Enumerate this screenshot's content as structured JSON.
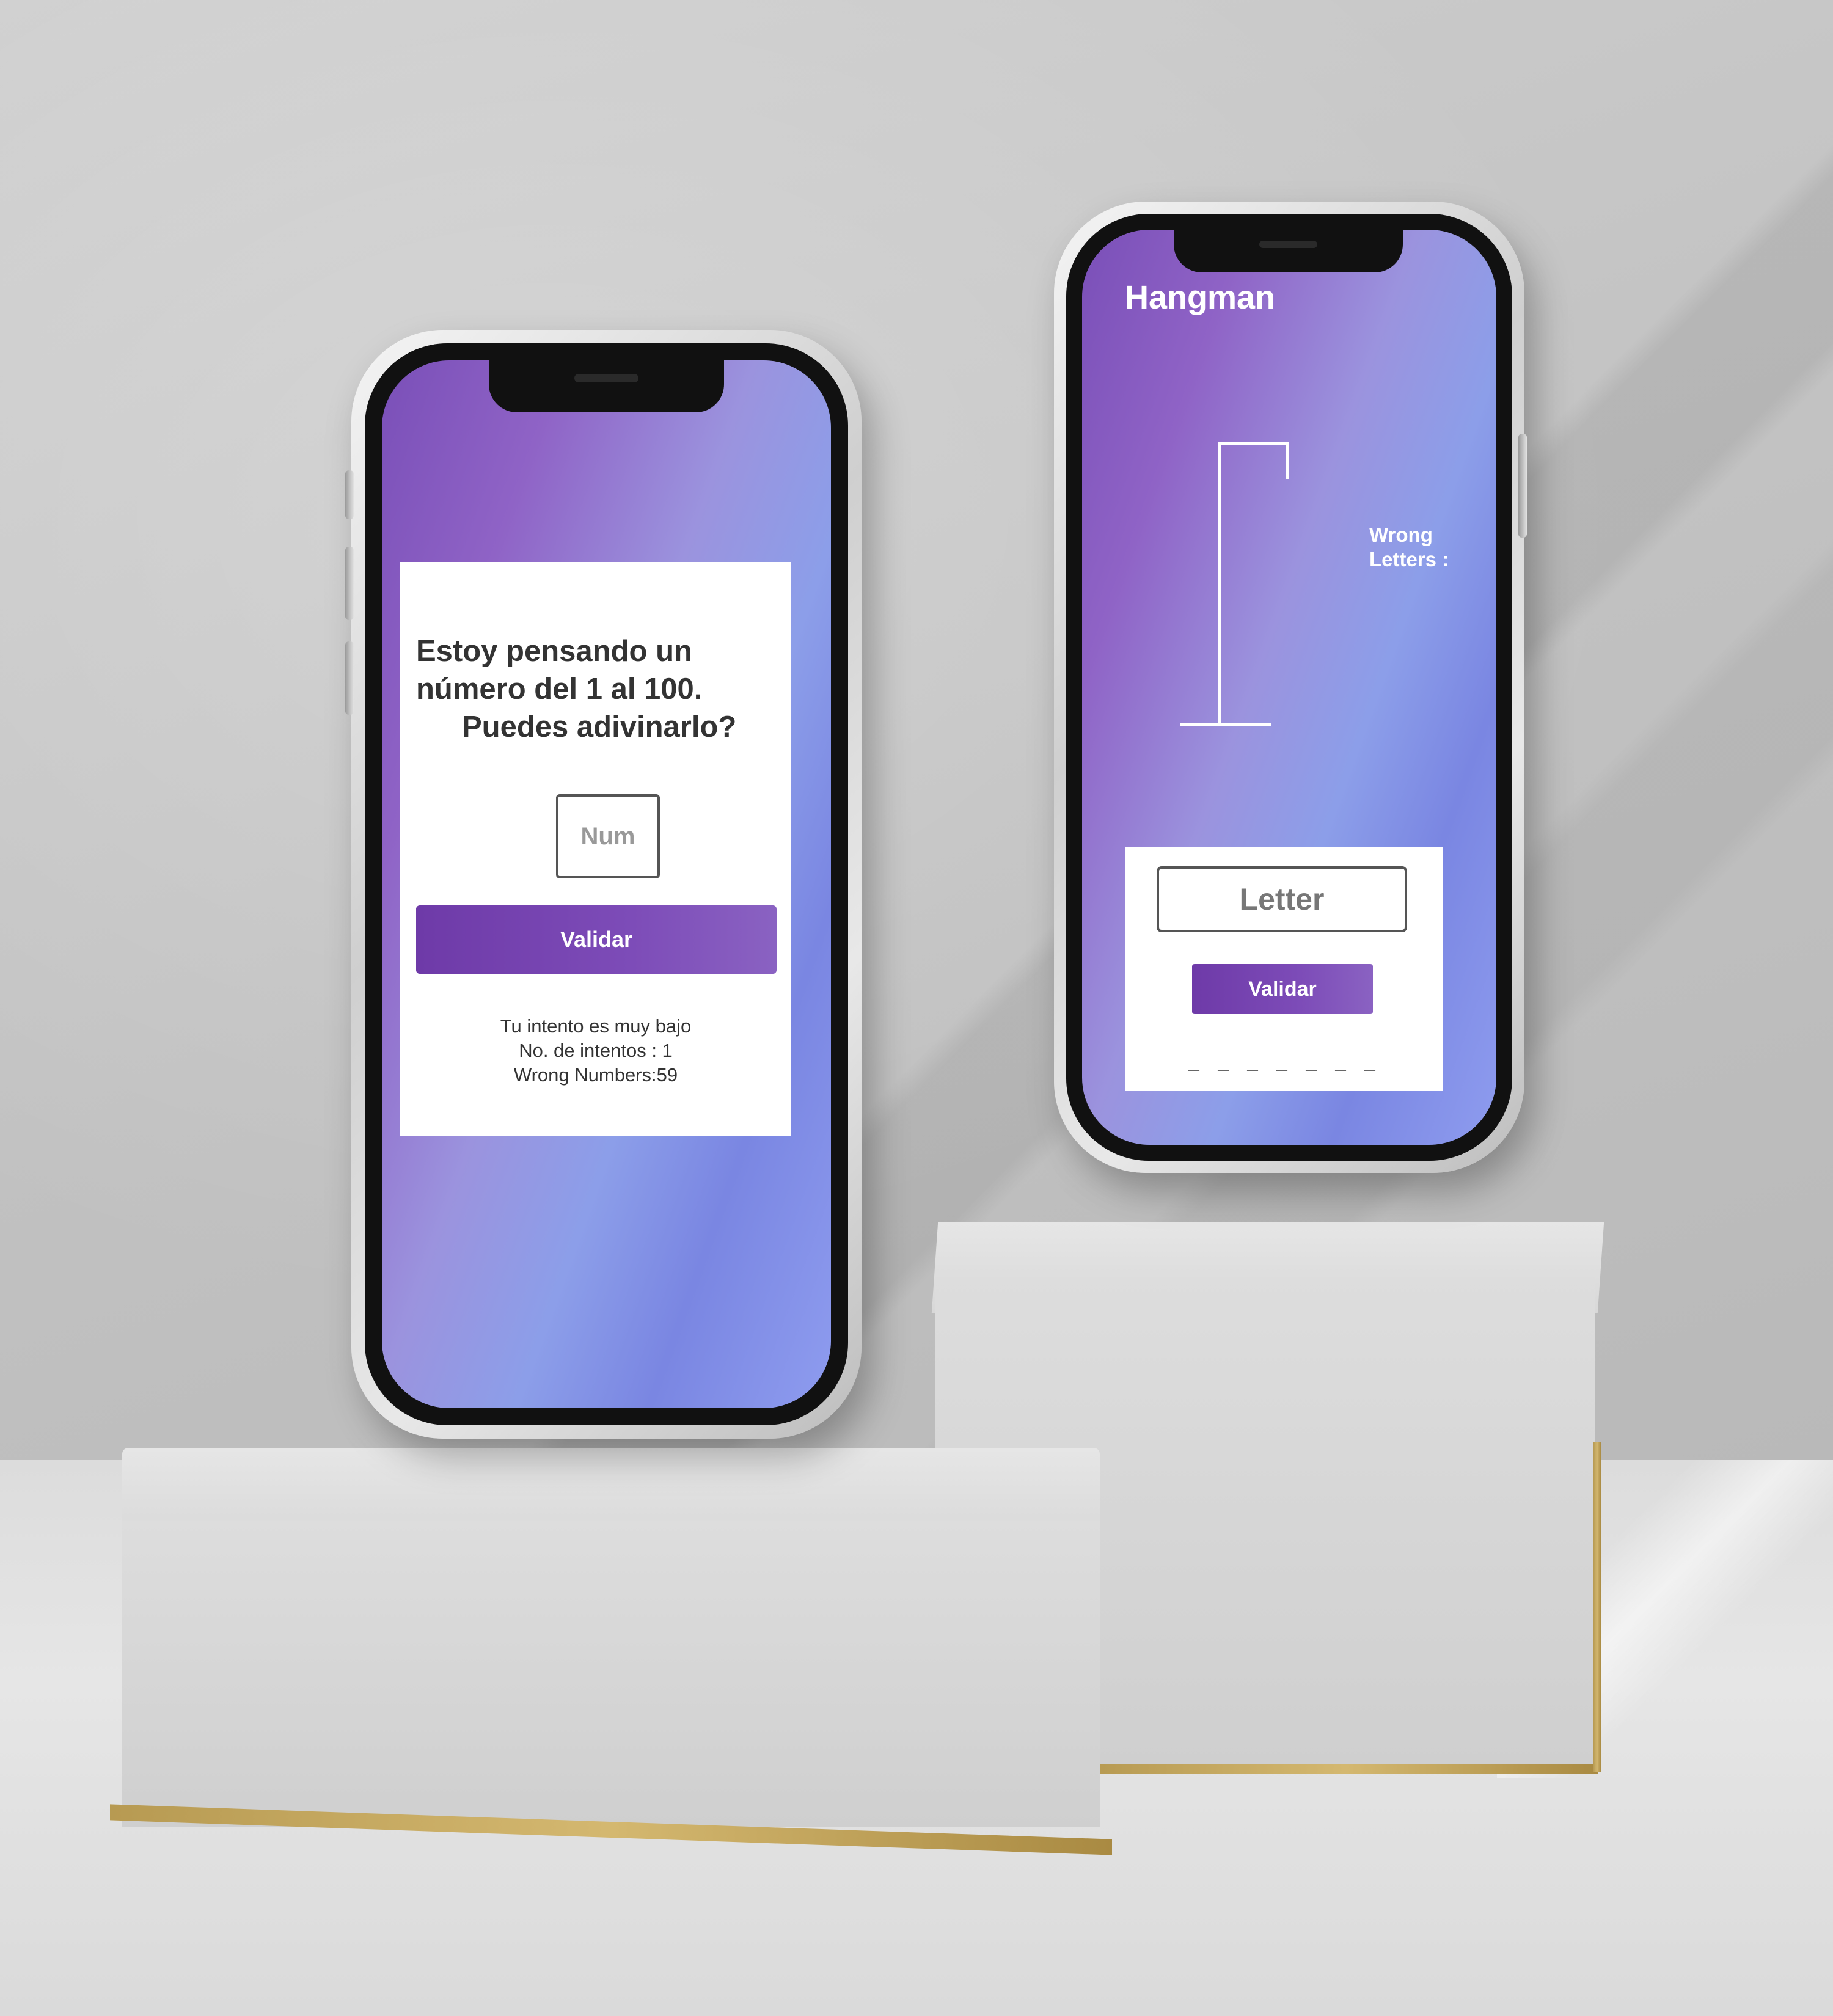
{
  "number_game": {
    "prompt_line1": "Estoy pensando un",
    "prompt_line2": "número del 1 al 100.",
    "prompt_line3": "Puedes adivinarlo?",
    "input_placeholder": "Num",
    "input_value": "",
    "validate_label": "Validar",
    "feedback_hint": "Tu intento es muy bajo",
    "attempts_text": "No. de intentos : 1",
    "wrong_numbers_text": "Wrong Numbers:59"
  },
  "hangman": {
    "title": "Hangman",
    "wrong_letters_line1": "Wrong",
    "wrong_letters_line2": "Letters :",
    "wrong_letters_value": "",
    "input_placeholder": "Letter",
    "input_value": "",
    "validate_label": "Validar",
    "word_blanks": "_ _ _ _ _ _ _"
  },
  "colors": {
    "accent_purple": "#7d4cb8",
    "screen_gradient_start": "#7a4fb8",
    "screen_gradient_end": "#8e9cef",
    "card_background": "#ffffff",
    "text_dark": "#333333"
  }
}
